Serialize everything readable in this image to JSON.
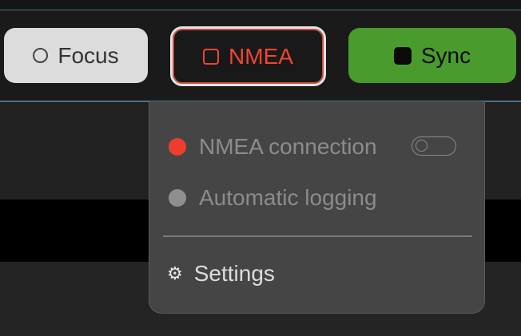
{
  "toolbar": {
    "focus_label": "Focus",
    "nmea_label": "NMEA",
    "sync_label": "Sync"
  },
  "dropdown": {
    "items": [
      {
        "label": "NMEA connection",
        "status": "red",
        "toggle": false
      },
      {
        "label": "Automatic logging",
        "status": "gray"
      }
    ],
    "settings_label": "Settings",
    "settings_icon": "⚙"
  },
  "colors": {
    "accent_green": "#4a9b2d",
    "nmea_red": "#ef4533",
    "status_red": "#ee3d2e",
    "status_gray": "#8f8f8f"
  }
}
